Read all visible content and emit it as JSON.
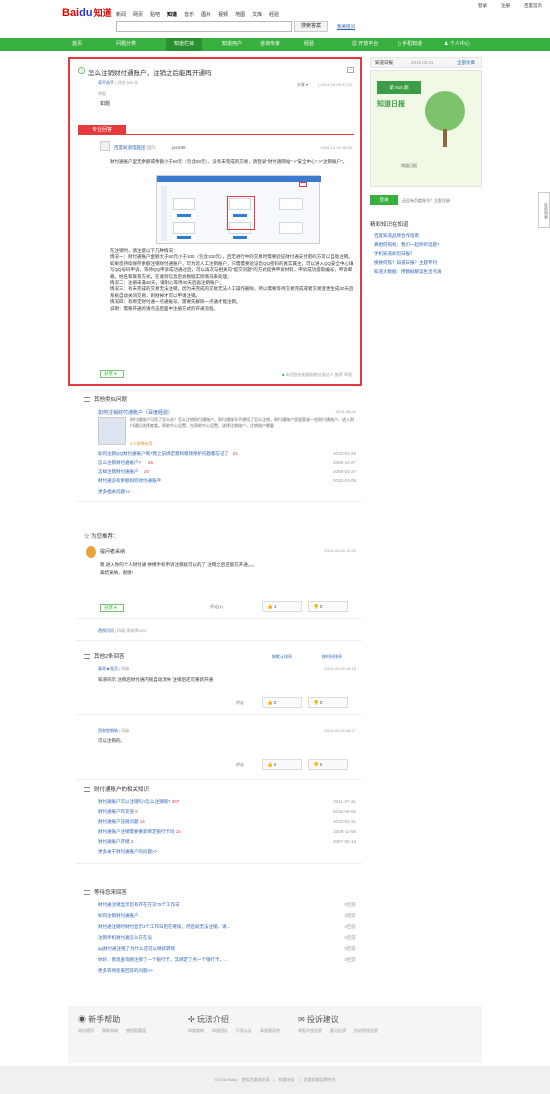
{
  "header": {
    "logo_bai": "Bai",
    "logo_du": "du",
    "logo_zd": "知道",
    "nav": [
      "新闻",
      "网页",
      "贴吧",
      "知道",
      "音乐",
      "图片",
      "视频",
      "地图",
      "文库",
      "经验"
    ],
    "top_links": [
      "登录",
      "注册",
      "百度首页"
    ],
    "search_placeholder": "",
    "search_button": "搜索答案",
    "ask_link": "我要提问"
  },
  "greennav": {
    "items": [
      "首页",
      "问题分类",
      "知道栏目",
      "知道用户",
      "咨询专家",
      "经验"
    ],
    "right_items": [
      "开放平台",
      "手机知道",
      "个人中心"
    ]
  },
  "question": {
    "title": "怎么注销财付通账户，注销之后能再开通吗",
    "asker": "蒋平选手",
    "asker_level": "|  浏览 559 次",
    "share": "分享 ▾",
    "date": "| 2014-04-25 07:22",
    "report": "举报",
    "body": "如题"
  },
  "answer": {
    "badge": "专业回答",
    "user": "百度知道电脑团",
    "user_tag": "团队",
    "name": "jaxtr88",
    "date": "2016-12-10 16:32",
    "intro": "财付通账户里无余额或余额小于50元（包含50元），没有未完成的交易，请登录\"财付通网站\"->\"安全中心\"->\"注销账户\"。",
    "paras": [
      "在注销时，请注意以下几种情况：",
      "情况一：财付通账户金额大于50元小于100（包含100元），且无进行中的交易时需要验证财付通支付密码方可以自助注销。如果您持续保存余额注销财付通账户，可为您人工注销账户，只需需要验证您QQ密码的真实属主，可以进入QQ安全中心填写QQ号码申诉，等待QQ申诉成功通过后，可以再次与相关向\"提交问题\"的方式提供申诉材料，申诉成功提取编号，申诉邮箱，姓名和联系方式，在收到信息后会根据实际情况来处理；",
      "情况二：注册未满30天，请耐心等待30天后再注销账户；",
      "情况三：有未完成的交易无法注销，因为未完成的交易无法人工操作删除，所以需要等待交易完成或者交易变更生成30天后系统自动关闭交易，则财掉才可以申请注销。",
      "情况四：有绑定财付通一点通账号，需要先解除一点通才能注销。",
      "说明：需要开通的请点击后面中注册方式的开通流程。"
    ],
    "share": "分享 ▾",
    "foot_from": "本回答由电脑网络分类达人 推荐",
    "foot_report": "举报"
  },
  "similar": {
    "title": "其他类似问题",
    "featured_title": "如何注销财付通账户（百度经验）",
    "featured_date": "2014-06-01",
    "featured_text": "财付通账户可用了怎么办？怎么注销财付通账户。财付通账号不想用了怎么注销，财付通账户里面登录一些财付通账户，进入财付通后选择查看。帮助中心设置，在帮助中心设置，选择注销账户，注销账户需要",
    "featured_votes": "4人觉得有用",
    "items": [
      {
        "q": "如何注销QQ财付通账户啊?我之前绑定嗯和嗯钱保护问题都忘记了",
        "n": "61",
        "d": "2010-01-25"
      },
      {
        "q": "怎么注销财付通账户?",
        "n": "56",
        "d": "2009-10-27"
      },
      {
        "q": "怎样注销财付通账户",
        "n": "20",
        "d": "2008-03-27"
      },
      {
        "q": "财付通没有余额如何财付通账户",
        "n": "7",
        "d": "2010-01-05"
      }
    ],
    "more": "更多相关问题>>"
  },
  "recommend": {
    "title": "为您推荐：",
    "user": "提问者采纳",
    "date": "2014-04-25 12:09",
    "text": "嗯 进入你的个人财付通 拼搏手机申诉注销就可以的了 注销之后还能在开通。。。",
    "text2": "裁结采纳，谢谢!",
    "rate_label": "评论(1)",
    "up": "1",
    "down": "0",
    "share": "分享 ▾",
    "user_name": "透视问问",
    "user_level": "| 四级",
    "user_rate": "采纳率83%"
  },
  "others": {
    "title": "其他2条回答",
    "sort1": "按默认排序",
    "sort2": "按时间排序",
    "a1_user": "春哥★党员",
    "a1_level": "| 四级",
    "a1_date": "2014-04-25 16:15",
    "a1_text": "知道吗示 注销后财付通内钱自动消失 注销后还可重新开通",
    "a1_comment": "评论",
    "a1_up": "0",
    "a1_down": "0",
    "a2_user": "西和牧钢纳",
    "a2_level": "| 四级",
    "a2_date": "2014-04-25 08:17",
    "a2_text": "可以注销的。",
    "a2_comment": "评论",
    "a2_up": "0",
    "a2_down": "0"
  },
  "related": {
    "title": "财付通账户的相关知识",
    "items": [
      {
        "q": "财付通账户可以注销吗?怎么注销呢?",
        "n": "307",
        "d": "2011-07-31"
      },
      {
        "q": "财付通账户咋充值",
        "n": "6",
        "d": "2016-05-05"
      },
      {
        "q": "财付通账户违规问题",
        "n": "14",
        "d": "2010-03-31"
      },
      {
        "q": "财付通账户注销需要重新绑定银行卡吗",
        "n": "15",
        "d": "2009-11-06"
      },
      {
        "q": "财付通账户存储",
        "n": "2",
        "d": "2007-05-13"
      }
    ],
    "more": "更多关于财付通账户的问题>>"
  },
  "waiting": {
    "title": "等待您来回答",
    "items": [
      {
        "q": "财付通注销显示您有存在在交75个工作日",
        "r": "0回答"
      },
      {
        "q": "如何注销财付通账户",
        "r": "0回答"
      },
      {
        "q": "财付通注销时财付显示3个工作日后在继续，然后就无法注销，请...",
        "r": "0回答"
      },
      {
        "q": "注销手机财付通怎么在在设",
        "r": "0回答"
      },
      {
        "q": "qq财付通注销了为什么还可以继续转钱",
        "r": "0回答"
      },
      {
        "q": "你好，我现查询刚注销了一个银行卡，又绑定了另一个银行卡，...",
        "r": "0回答"
      }
    ],
    "more": "更多等待您来回答的问题>>"
  },
  "rail": {
    "head": "知道日报",
    "date": "2016.03.01",
    "past": "全部文章",
    "banner": "第 915 期",
    "pic_title": "知道日报",
    "pic_label": "知道日报",
    "login": "登录",
    "login_hint": "还没有百度账号？立即注册",
    "sec_title": "精彩知识在知道",
    "links": [
      "百度知道品牌合作指南",
      "真相何照机：我们一起听听话题?",
      "手机知道如何日报？",
      "换换何照？知道日报？主题专刊",
      "知道大数据：用数据解读生活点滴"
    ]
  },
  "float_btn": "任务列表",
  "help": {
    "c1_title": "新手帮助",
    "c1_links": "如何提问　　获取采纳　　使用财富值",
    "c2_title": "玩法介绍",
    "c2_links": "知道商城　　知道团队　　行家认证　　高质量问答",
    "c3_title": "投诉建议",
    "c3_links": "举报不良信息　　意见反馈　　投诉侵权信息"
  },
  "footer": "©2016 Baidu　使用百度前必读　|　知道协议　|　百度知道品牌合作"
}
